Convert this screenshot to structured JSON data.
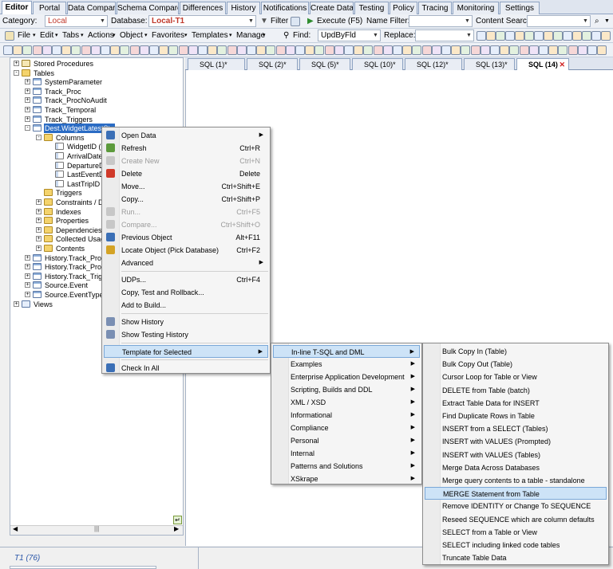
{
  "tabs": [
    "Editor",
    "Portal",
    "Data Compare",
    "Schema Compare",
    "Differences",
    "History",
    "Notifications",
    "Create Data",
    "Testing",
    "Policy",
    "Tracing",
    "Monitoring",
    "Settings"
  ],
  "row1": {
    "category_label": "Category:",
    "category_value": "Local",
    "database_label": "Database:",
    "database_value": "Local-T1",
    "filter": "Filter",
    "execute": "Execute (F5)",
    "name_filter": "Name Filter:",
    "content_search": "Content Search:"
  },
  "row2": {
    "menus": [
      "File",
      "Edit",
      "Tabs",
      "Actions",
      "Object",
      "Favorites",
      "Templates",
      "Manage"
    ],
    "find_label": "Find:",
    "find_value": "UpdByFld",
    "replace_label": "Replace:"
  },
  "sql_tabs": [
    "SQL (1)*",
    "SQL (2)*",
    "SQL (5)*",
    "SQL (10)*",
    "SQL (12)*",
    "SQL (13)*",
    "SQL (14)"
  ],
  "tree": [
    {
      "t": "Stored Procedures",
      "lvl": 0,
      "ic": "proc",
      "ex": "+"
    },
    {
      "t": "Tables",
      "lvl": 0,
      "ic": "fld",
      "ex": "-"
    },
    {
      "t": "SystemParameter",
      "lvl": 1,
      "ic": "tbl",
      "ex": "+"
    },
    {
      "t": "Track_Proc",
      "lvl": 1,
      "ic": "tbl",
      "ex": "+"
    },
    {
      "t": "Track_ProcNoAudit",
      "lvl": 1,
      "ic": "tbl",
      "ex": "+"
    },
    {
      "t": "Track_Temporal",
      "lvl": 1,
      "ic": "tbl",
      "ex": "+"
    },
    {
      "t": "Track_Triggers",
      "lvl": 1,
      "ic": "tbl",
      "ex": "+"
    },
    {
      "t": "Dest.WidgetLatestSta",
      "lvl": 1,
      "ic": "tbl",
      "ex": "-",
      "sel": true
    },
    {
      "t": "Columns",
      "lvl": 2,
      "ic": "fld",
      "ex": "-"
    },
    {
      "t": "WidgetID (int",
      "lvl": 3,
      "ic": "col",
      "ex": ""
    },
    {
      "t": "ArrivalDate (d",
      "lvl": 3,
      "ic": "col",
      "ex": ""
    },
    {
      "t": "DepartureDat",
      "lvl": 3,
      "ic": "col",
      "ex": ""
    },
    {
      "t": "LastEventDat",
      "lvl": 3,
      "ic": "col",
      "ex": ""
    },
    {
      "t": "LastTripID (in",
      "lvl": 3,
      "ic": "col",
      "ex": ""
    },
    {
      "t": "Triggers",
      "lvl": 2,
      "ic": "fld",
      "ex": ""
    },
    {
      "t": "Constraints / Defa",
      "lvl": 2,
      "ic": "fld",
      "ex": "+"
    },
    {
      "t": "Indexes",
      "lvl": 2,
      "ic": "fld",
      "ex": "+"
    },
    {
      "t": "Properties",
      "lvl": 2,
      "ic": "fld",
      "ex": "+"
    },
    {
      "t": "Dependencies",
      "lvl": 2,
      "ic": "fld",
      "ex": "+"
    },
    {
      "t": "Collected Usage",
      "lvl": 2,
      "ic": "fld",
      "ex": "+"
    },
    {
      "t": "Contents",
      "lvl": 2,
      "ic": "fld",
      "ex": "+"
    },
    {
      "t": "History.Track_Proc",
      "lvl": 1,
      "ic": "tbl",
      "ex": "+"
    },
    {
      "t": "History.Track_ProcNo",
      "lvl": 1,
      "ic": "tbl",
      "ex": "+"
    },
    {
      "t": "History.Track_Trigger",
      "lvl": 1,
      "ic": "tbl",
      "ex": "+"
    },
    {
      "t": "Source.Event",
      "lvl": 1,
      "ic": "tbl",
      "ex": "+"
    },
    {
      "t": "Source.EventType",
      "lvl": 1,
      "ic": "tbl",
      "ex": "+"
    },
    {
      "t": "Views",
      "lvl": 0,
      "ic": "view",
      "ex": "+"
    }
  ],
  "context_menu": [
    {
      "t": "Open Data",
      "arrow": true,
      "ic": "#3b6fb6"
    },
    {
      "t": "Refresh",
      "s": "Ctrl+R",
      "ic": "#5c9a3c"
    },
    {
      "t": "Create New",
      "s": "Ctrl+N",
      "dis": true,
      "ic": "#c7c7c7"
    },
    {
      "t": "Delete",
      "s": "Delete",
      "ic": "#d03a2a"
    },
    {
      "t": "Move...",
      "s": "Ctrl+Shift+E"
    },
    {
      "t": "Copy...",
      "s": "Ctrl+Shift+P"
    },
    {
      "t": "Run...",
      "s": "Ctrl+F5",
      "dis": true,
      "ic": "#c7c7c7"
    },
    {
      "t": "Compare...",
      "s": "Ctrl+Shift+O",
      "dis": true,
      "ic": "#c7c7c7"
    },
    {
      "t": "Previous Object",
      "s": "Alt+F11",
      "ic": "#3b6fb6"
    },
    {
      "t": "Locate Object (Pick Database)",
      "s": "Ctrl+F2",
      "ic": "#d4a325"
    },
    {
      "t": "Advanced",
      "arrow": true
    },
    {
      "sep": true
    },
    {
      "t": "UDPs...",
      "s": "Ctrl+F4"
    },
    {
      "t": "Copy, Test and Rollback..."
    },
    {
      "t": "Add to Build..."
    },
    {
      "sep": true
    },
    {
      "t": "Show History",
      "ic": "#7a8fb3"
    },
    {
      "t": "Show Testing History",
      "ic": "#7a8fb3"
    },
    {
      "sep": true
    },
    {
      "t": "Template for Selected",
      "arrow": true,
      "sel": true
    },
    {
      "sep": true
    },
    {
      "t": "Check In All",
      "ic": "#3b6fb6"
    }
  ],
  "submenu1": [
    {
      "t": "In-line T-SQL and DML",
      "sel": true
    },
    {
      "t": "Examples"
    },
    {
      "t": "Enterprise Application Development"
    },
    {
      "t": "Scripting, Builds and DDL"
    },
    {
      "t": "XML / XSD"
    },
    {
      "t": "Informational"
    },
    {
      "t": "Compliance"
    },
    {
      "t": "Personal"
    },
    {
      "t": "Internal"
    },
    {
      "t": "Patterns and Solutions"
    },
    {
      "t": "XSkrape"
    }
  ],
  "submenu2": [
    "Bulk Copy In (Table)",
    "Bulk Copy Out (Table)",
    "Cursor Loop for Table or View",
    "DELETE from Table (batch)",
    "Extract Table Data for INSERT",
    "Find Duplicate Rows in Table",
    "INSERT from a SELECT (Tables)",
    "INSERT with VALUES (Prompted)",
    "INSERT with VALUES (Tables)",
    "Merge Data Across Databases",
    "Merge query contents to a table - standalone",
    "MERGE Statement from Table",
    "Remove IDENTITY or Change To SEQUENCE",
    "Reseed SEQUENCE which are column defaults",
    "SELECT from a Table or View",
    "SELECT including linked code tables",
    "Truncate Table Data"
  ],
  "submenu2_selected": "MERGE Statement from Table",
  "status": {
    "connection": "T1 (76)"
  }
}
